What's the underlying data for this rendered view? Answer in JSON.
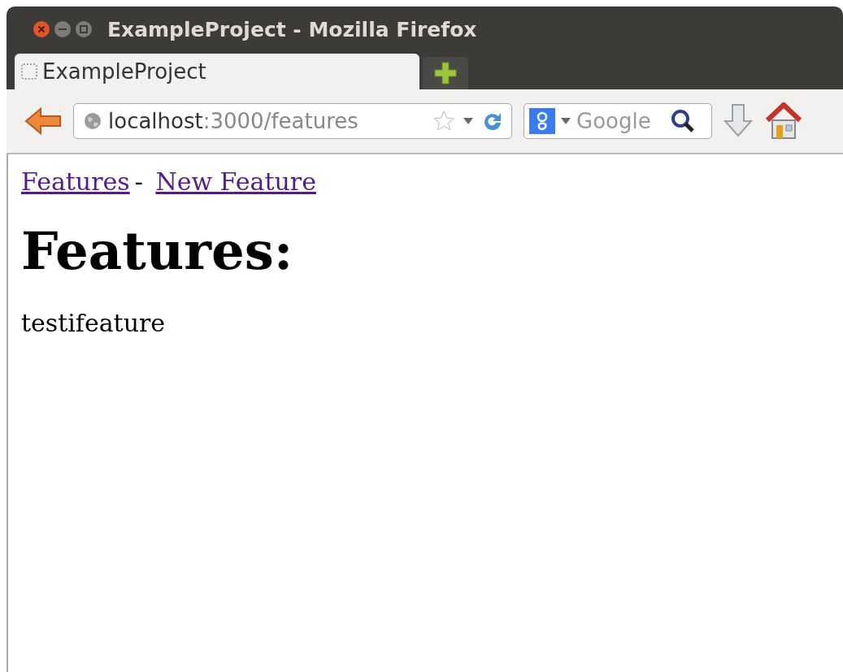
{
  "window": {
    "title": "ExampleProject - Mozilla Firefox"
  },
  "tabs": [
    {
      "label": "ExampleProject",
      "selected": true
    }
  ],
  "url": {
    "host": "localhost",
    "rest": ":3000/features"
  },
  "search": {
    "placeholder": "Google"
  },
  "nav": {
    "links": [
      "Features",
      "New Feature"
    ],
    "separator": "-"
  },
  "heading": "Features:",
  "items": [
    "testifeature"
  ]
}
